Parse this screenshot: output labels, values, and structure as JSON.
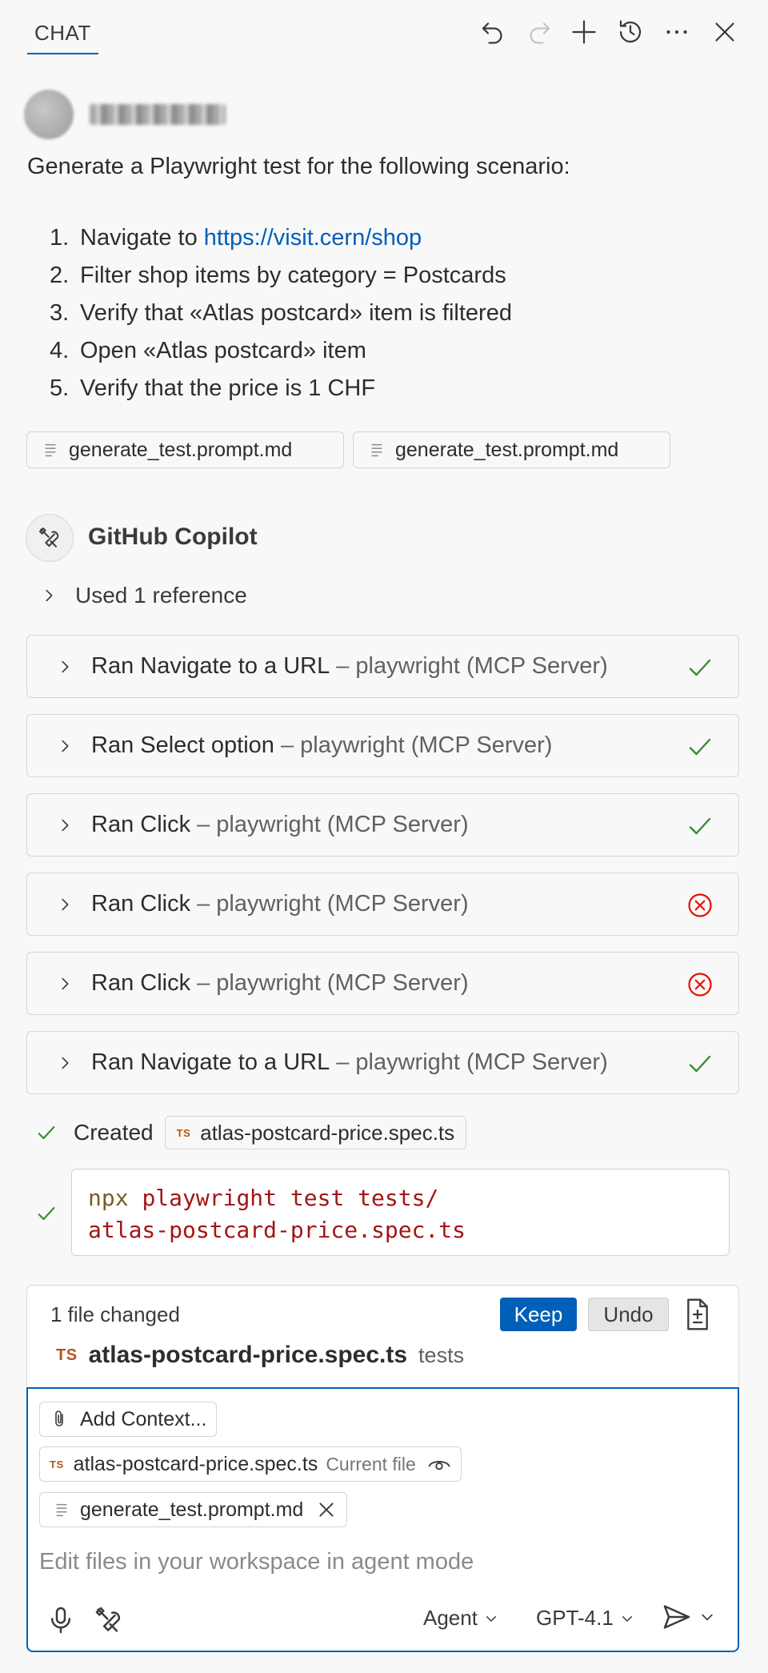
{
  "header": {
    "tab_label": "CHAT",
    "icons": [
      "undo-icon",
      "redo-icon",
      "plus-icon",
      "history-icon",
      "more-icon",
      "close-icon"
    ]
  },
  "user_message": {
    "prompt": "Generate a Playwright test for the following scenario:",
    "steps": [
      {
        "num": "1.",
        "text": "Navigate to ",
        "link": "https://visit.cern/shop"
      },
      {
        "num": "2.",
        "text": "Filter shop items by category = Postcards"
      },
      {
        "num": "3.",
        "text": "Verify that «Atlas postcard» item is filtered"
      },
      {
        "num": "4.",
        "text": "Open «Atlas postcard» item"
      },
      {
        "num": "5.",
        "text": "Verify that the price is 1 CHF"
      }
    ],
    "attachments": [
      "generate_test.prompt.md",
      "generate_test.prompt.md"
    ]
  },
  "response": {
    "author": "GitHub Copilot",
    "used_references": "Used 1 reference",
    "tool_runs": [
      {
        "action": "Ran Navigate to a URL",
        "source": "– playwright (MCP Server)",
        "status": "success"
      },
      {
        "action": "Ran Select option",
        "source": "– playwright (MCP Server)",
        "status": "success"
      },
      {
        "action": "Ran Click",
        "source": "– playwright (MCP Server)",
        "status": "success"
      },
      {
        "action": "Ran Click",
        "source": "– playwright (MCP Server)",
        "status": "error"
      },
      {
        "action": "Ran Click",
        "source": "– playwright (MCP Server)",
        "status": "error"
      },
      {
        "action": "Ran Navigate to a URL",
        "source": "– playwright (MCP Server)",
        "status": "success"
      }
    ],
    "created_label": "Created",
    "created_file_badge": "TS",
    "created_file": "atlas-postcard-price.spec.ts",
    "command_cmd": "npx",
    "command_args_line1": "playwright test tests/",
    "command_args_line2": "atlas-postcard-price.spec.ts"
  },
  "changes": {
    "summary": "1 file changed",
    "keep_label": "Keep",
    "undo_label": "Undo",
    "file_badge": "TS",
    "file_name": "atlas-postcard-price.spec.ts",
    "file_dir": "tests"
  },
  "input": {
    "add_context_label": "Add Context...",
    "context_files": [
      {
        "badge": "TS",
        "name": "atlas-postcard-price.spec.ts",
        "note": "Current file"
      },
      {
        "name": "generate_test.prompt.md"
      }
    ],
    "placeholder": "Edit files in your workspace in agent mode",
    "mode_label": "Agent",
    "model_label": "GPT-4.1"
  },
  "colors": {
    "accent": "#005fb8",
    "success": "#388a34",
    "error": "#e51400"
  }
}
